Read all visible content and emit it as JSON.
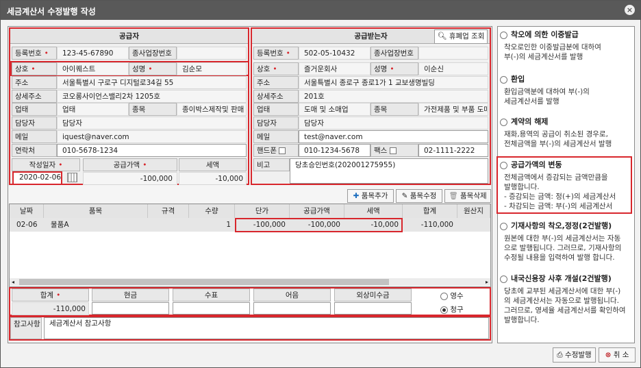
{
  "window": {
    "title": "세금계산서 수정발행 작성",
    "close_glyph": "×"
  },
  "supplier": {
    "header": "공급자",
    "reg_no_label": "등록번호",
    "reg_no": "123-45-67890",
    "sub_biz_label": "종사업장번호",
    "sub_biz": "",
    "name_label": "상호",
    "name": "아이퀘스트",
    "ceo_label": "성명",
    "ceo": "김순모",
    "addr_label": "주소",
    "addr": "서울특별시 구로구 디지털로34길 55",
    "addr2_label": "상세주소",
    "addr2": "코오롱사이언스밸리2차 1205호",
    "biz_type_label": "업태",
    "biz_type": "업태",
    "biz_item_label": "종목",
    "biz_item": "종이박스제작및 판매",
    "manager_label": "담당자",
    "manager": "담당자",
    "email_label": "메일",
    "email": "iquest@naver.com",
    "contact_label": "연락처",
    "contact": "010-5678-1234"
  },
  "buyer": {
    "header": "공급받는자",
    "lookup_button": "휴폐업 조회",
    "reg_no_label": "등록번호",
    "reg_no": "502-05-10432",
    "sub_biz_label": "종사업장번호",
    "sub_biz": "",
    "name_label": "상호",
    "name": "즐거운회사",
    "ceo_label": "성명",
    "ceo": "이순신",
    "addr_label": "주소",
    "addr": "서울특별시 종로구 종로1가 1 교보생명빌딩",
    "addr2_label": "상세주소",
    "addr2": "201호",
    "biz_type_label": "업태",
    "biz_type": "도매 및 소매업",
    "biz_item_label": "종목",
    "biz_item": "가전제품 및 부품 도매",
    "manager_label": "담당자",
    "manager": "담당자",
    "email_label": "메일",
    "email": "test@naver.com",
    "phone_label": "핸드폰",
    "phone": "010-1234-5678",
    "fax_label": "팩스",
    "fax": "02-1111-2222",
    "remark_label": "비고",
    "remark": "당초승인번호(202001275955)"
  },
  "amounts": {
    "date_label": "작성일자",
    "date": "2020-02-06",
    "supply_label": "공급가액",
    "supply": "-100,000",
    "tax_label": "세액",
    "tax": "-10,000"
  },
  "item_buttons": {
    "add": "품목추가",
    "edit": "품목수정",
    "delete": "품목삭제"
  },
  "grid": {
    "headers": [
      "날짜",
      "품목",
      "규격",
      "수량",
      "단가",
      "공급가액",
      "세액",
      "합계",
      "원산지"
    ],
    "rows": [
      [
        "02-06",
        "물품A",
        "",
        "1",
        "-100,000",
        "-100,000",
        "-10,000",
        "-110,000",
        ""
      ]
    ]
  },
  "totals": {
    "headers": [
      "합계",
      "현금",
      "수표",
      "어음",
      "외상미수금"
    ],
    "total": "-110,000",
    "receipt": "영수",
    "claim": "청구",
    "selected": "claim"
  },
  "memo": {
    "label": "참고사항",
    "value": "세금계산서 참고사항"
  },
  "options": [
    {
      "title": "착오에 의한 이중발급",
      "desc": [
        "착오로인한 이중발급분에 대하여",
        "부(-)의 세금계산서를 발행"
      ]
    },
    {
      "title": "환입",
      "desc": [
        "환입금액분에 대하여 부(-)의",
        "세금계산서를 발행"
      ]
    },
    {
      "title": "계약의 해제",
      "desc": [
        "재화,용역의 공급이 취소된 경우로,",
        "전체금액을 부(-)의 세금계산서 발행"
      ]
    },
    {
      "title": "공급가액의 변동",
      "desc": [
        "전체금액에서 증감되는 금액만큼을",
        "발행합니다.",
        "- 증감되는 금액: 정(+)의 세금계산서",
        "- 차감되는 금액: 부(-)의 세금계산서"
      ]
    },
    {
      "title": "기재사항의 착오,정정(2건발행)",
      "desc": [
        "원본에 대한 부(-)의 세금계산서는 자동",
        "으로 발행됩니다. 그러므로, 기재사항의",
        "수정될 내용을 입력하여 발행 합니다."
      ]
    },
    {
      "title": "내국신용장 사후 개설(2건발행)",
      "desc": [
        "당초에 교부된 세금계산서에 대한 부(-)",
        "의 세금계산서는 자동으로 발행됩니다.",
        "그러므로, 영세율 세금계산서를 확인하여",
        "발행합니다."
      ]
    }
  ],
  "footer": {
    "issue": "수정발행",
    "cancel": "취 소"
  }
}
